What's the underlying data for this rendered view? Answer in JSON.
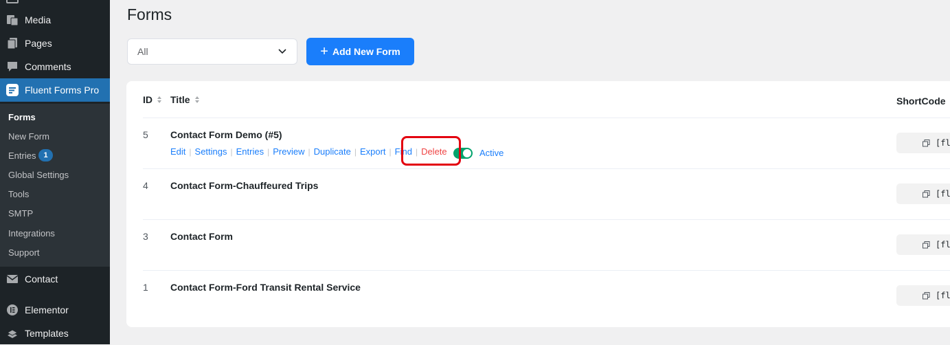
{
  "sidebar": {
    "menu": [
      {
        "label": "Media",
        "icon": "media-icon"
      },
      {
        "label": "Pages",
        "icon": "pages-icon"
      },
      {
        "label": "Comments",
        "icon": "comments-icon"
      },
      {
        "label": "Fluent Forms Pro",
        "icon": "fluent-forms-icon"
      },
      {
        "label": "Contact",
        "icon": "envelope-icon"
      },
      {
        "label": "Elementor",
        "icon": "elementor-icon"
      },
      {
        "label": "Templates",
        "icon": "templates-icon"
      }
    ],
    "submenu": [
      {
        "label": "Forms"
      },
      {
        "label": "New Form"
      },
      {
        "label": "Entries",
        "badge": "1"
      },
      {
        "label": "Global Settings"
      },
      {
        "label": "Tools"
      },
      {
        "label": "SMTP"
      },
      {
        "label": "Integrations"
      },
      {
        "label": "Support"
      }
    ]
  },
  "page": {
    "title": "Forms",
    "filter": {
      "value": "All"
    },
    "add_button": "Add New Form"
  },
  "table": {
    "headers": {
      "id": "ID",
      "title": "Title",
      "shortcode": "ShortCode"
    },
    "rows": [
      {
        "id": "5",
        "title": "Contact Form Demo (#5)",
        "shortcode": "[fl"
      },
      {
        "id": "4",
        "title": "Contact Form-Chauffeured Trips",
        "shortcode": "[fl"
      },
      {
        "id": "3",
        "title": "Contact Form",
        "shortcode": "[fl"
      },
      {
        "id": "1",
        "title": "Contact Form-Ford Transit Rental Service",
        "shortcode": "[fl"
      }
    ],
    "actions": [
      "Edit",
      "Settings",
      "Entries",
      "Preview",
      "Duplicate",
      "Export",
      "Find",
      "Delete"
    ],
    "status": "Active"
  },
  "colors": {
    "sidebar_bg": "#1d2327",
    "submenu_bg": "#2c3338",
    "active_menu": "#2271b1",
    "primary": "#1a7efb",
    "delete": "#ef4444",
    "toggle_on": "#00a36c",
    "highlight": "#e3000f"
  }
}
